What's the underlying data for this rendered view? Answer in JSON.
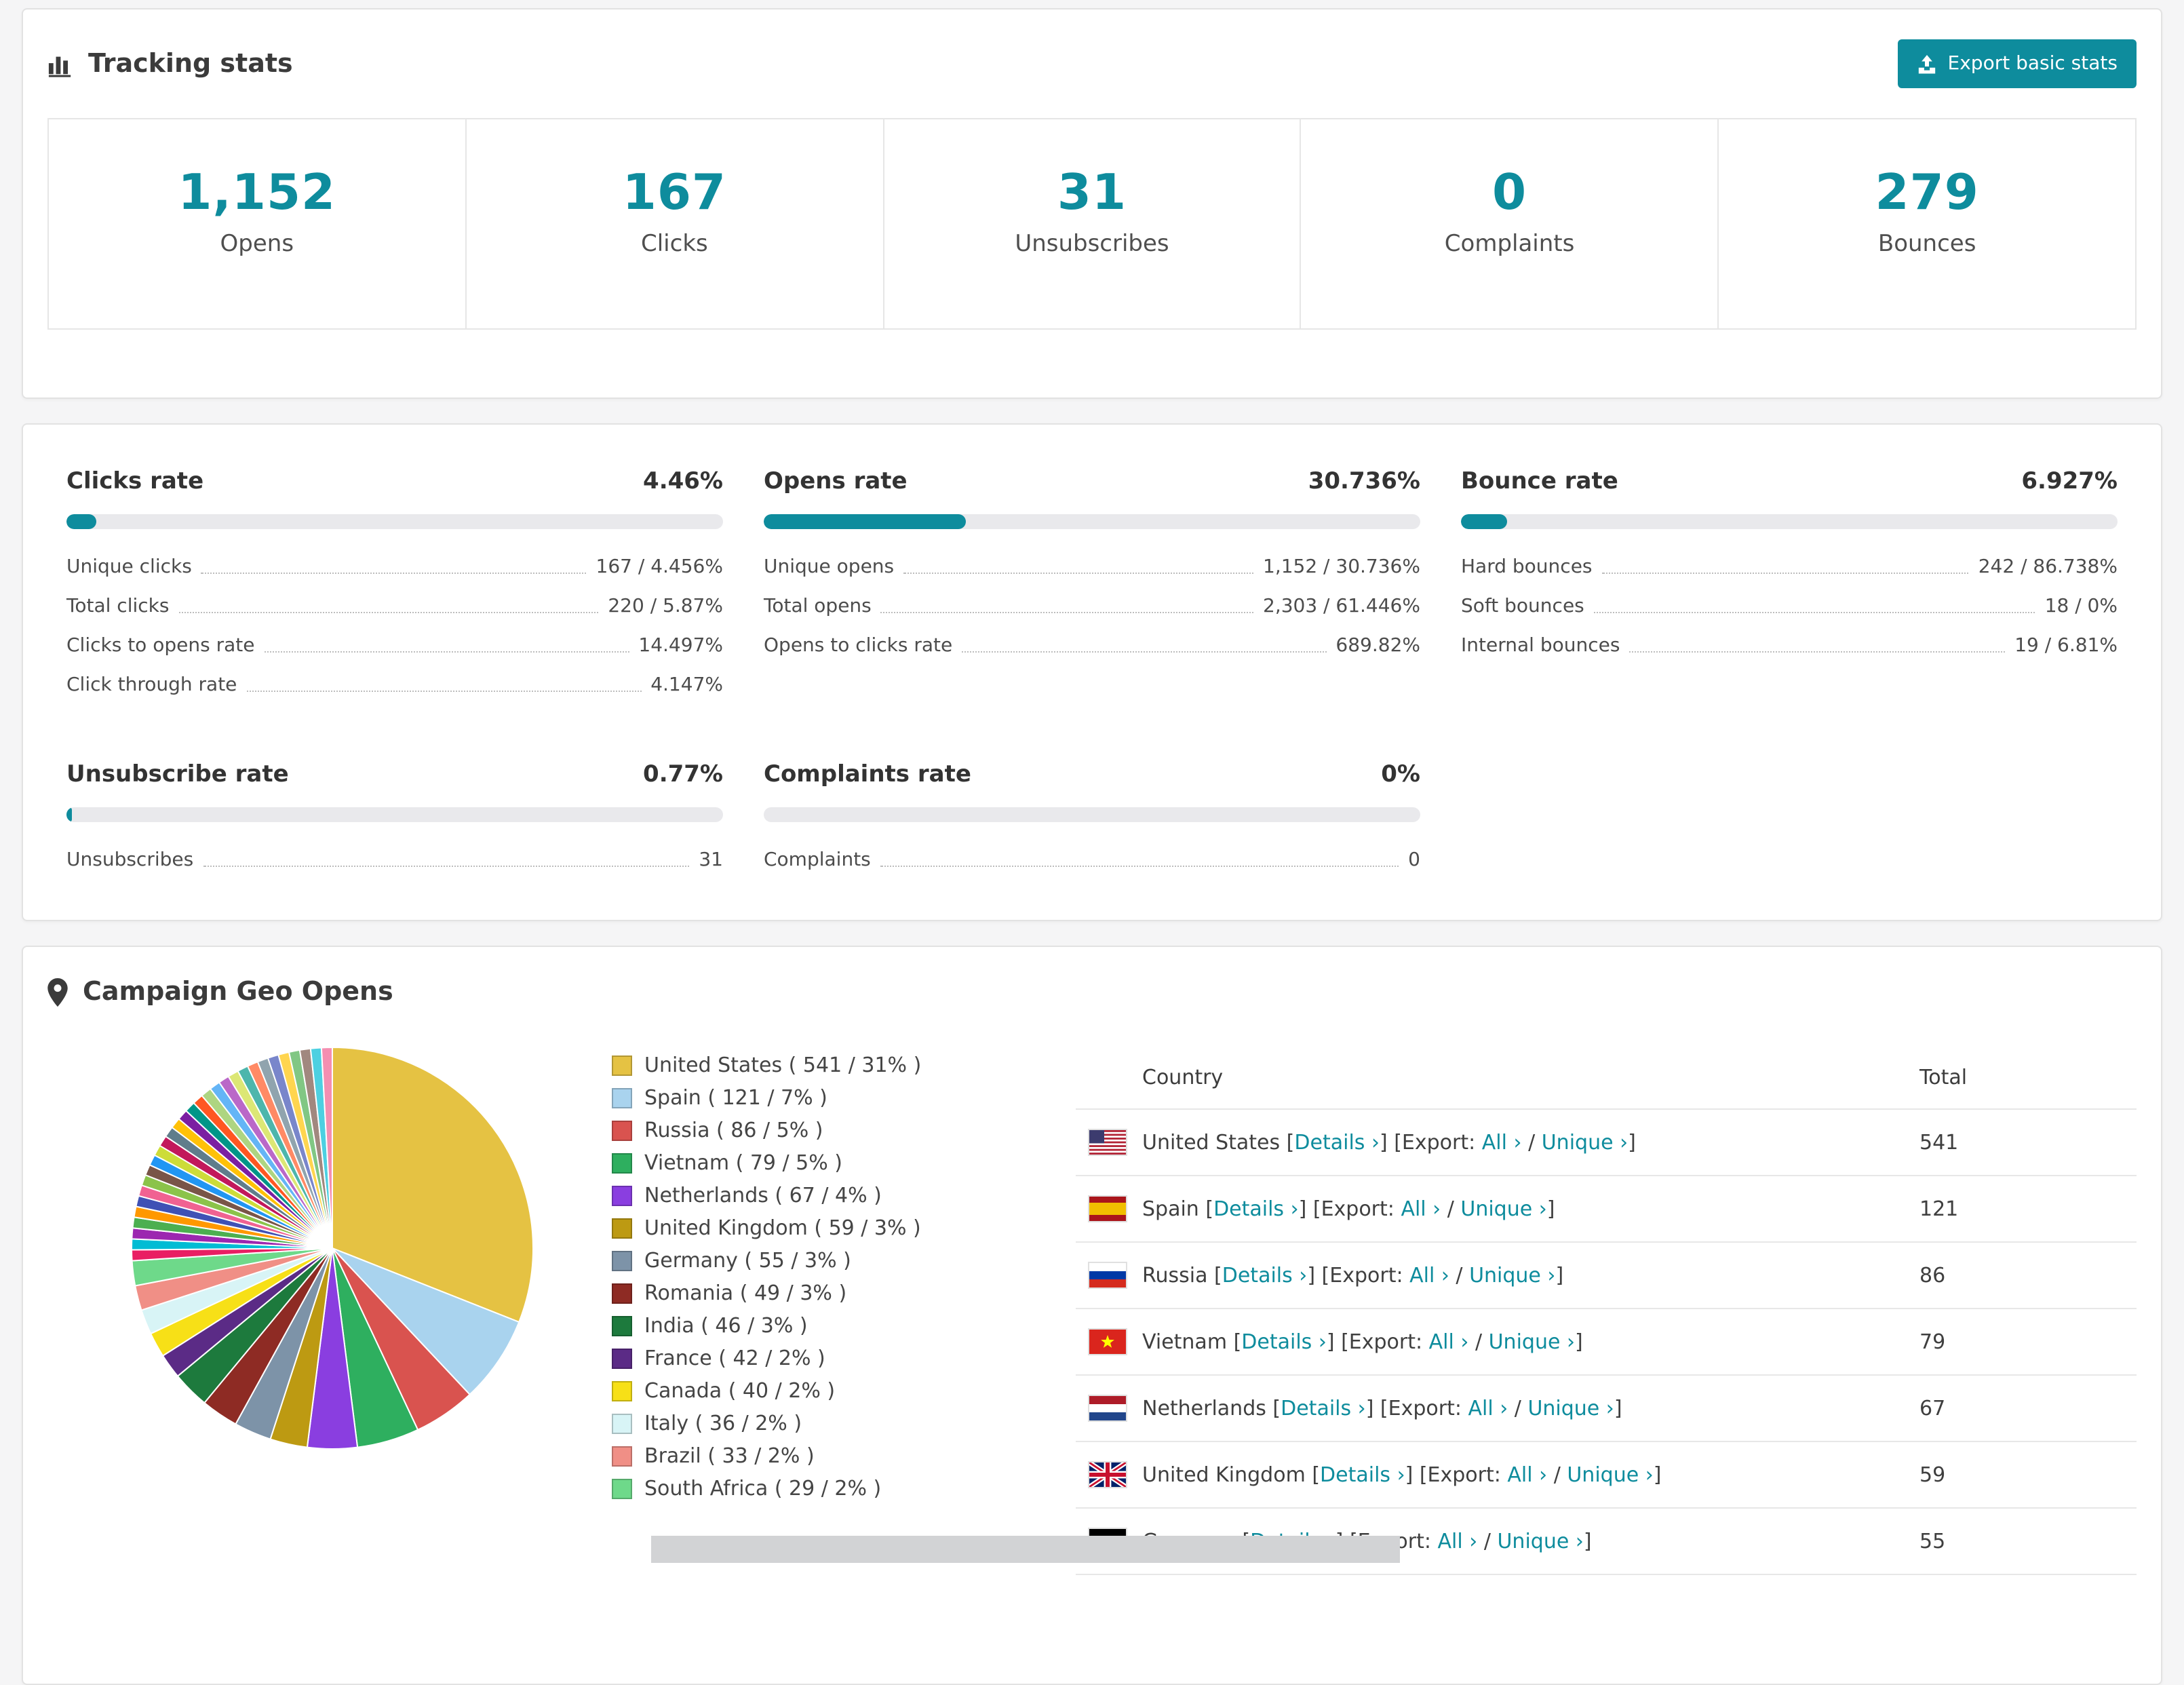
{
  "theme": {
    "accent": "#0e8c9d"
  },
  "tracking": {
    "title": "Tracking stats",
    "export_label": "Export basic stats",
    "stats": [
      {
        "value": "1,152",
        "label": "Opens"
      },
      {
        "value": "167",
        "label": "Clicks"
      },
      {
        "value": "31",
        "label": "Unsubscribes"
      },
      {
        "value": "0",
        "label": "Complaints"
      },
      {
        "value": "279",
        "label": "Bounces"
      }
    ]
  },
  "rates": {
    "blocks": [
      {
        "title": "Clicks rate",
        "value": "4.46%",
        "pct": 4.46,
        "rows": [
          {
            "label": "Unique clicks",
            "value": "167 / 4.456%"
          },
          {
            "label": "Total clicks",
            "value": "220 / 5.87%"
          },
          {
            "label": "Clicks to opens rate",
            "value": "14.497%"
          },
          {
            "label": "Click through rate",
            "value": "4.147%"
          }
        ]
      },
      {
        "title": "Opens rate",
        "value": "30.736%",
        "pct": 30.736,
        "rows": [
          {
            "label": "Unique opens",
            "value": "1,152 / 30.736%"
          },
          {
            "label": "Total opens",
            "value": "2,303 / 61.446%"
          },
          {
            "label": "Opens to clicks rate",
            "value": "689.82%"
          }
        ]
      },
      {
        "title": "Bounce rate",
        "value": "6.927%",
        "pct": 6.927,
        "rows": [
          {
            "label": "Hard bounces",
            "value": "242 / 86.738%"
          },
          {
            "label": "Soft bounces",
            "value": "18 / 0%"
          },
          {
            "label": "Internal bounces",
            "value": "19 / 6.81%"
          }
        ]
      },
      {
        "title": "Unsubscribe rate",
        "value": "0.77%",
        "pct": 0.77,
        "rows": [
          {
            "label": "Unsubscribes",
            "value": "31"
          }
        ]
      },
      {
        "title": "Complaints rate",
        "value": "0%",
        "pct": 0,
        "rows": [
          {
            "label": "Complaints",
            "value": "0"
          }
        ]
      }
    ]
  },
  "geo": {
    "title": "Campaign Geo Opens",
    "table": {
      "country_header": "Country",
      "total_header": "Total",
      "details_label": "Details ›",
      "export_label": "Export:",
      "all_label": "All ›",
      "unique_label": "Unique ›",
      "rows": [
        {
          "country": "United States",
          "flag": "us",
          "total": "541"
        },
        {
          "country": "Spain",
          "flag": "es",
          "total": "121"
        },
        {
          "country": "Russia",
          "flag": "ru",
          "total": "86"
        },
        {
          "country": "Vietnam",
          "flag": "vn",
          "total": "79"
        },
        {
          "country": "Netherlands",
          "flag": "nl",
          "total": "67"
        },
        {
          "country": "United Kingdom",
          "flag": "gb",
          "total": "59"
        },
        {
          "country": "Germany",
          "flag": "de",
          "total": "55"
        }
      ]
    }
  },
  "chart_data": {
    "type": "pie",
    "title": "Campaign Geo Opens",
    "legend_position": "right",
    "unit": "opens",
    "slices": [
      {
        "name": "United States",
        "value": 541,
        "pct": 31,
        "color": "#e5c243"
      },
      {
        "name": "Spain",
        "value": 121,
        "pct": 7,
        "color": "#a9d3ee"
      },
      {
        "name": "Russia",
        "value": 86,
        "pct": 5,
        "color": "#d9534f"
      },
      {
        "name": "Vietnam",
        "value": 79,
        "pct": 5,
        "color": "#2eaf5f"
      },
      {
        "name": "Netherlands",
        "value": 67,
        "pct": 4,
        "color": "#8a3ee0"
      },
      {
        "name": "United Kingdom",
        "value": 59,
        "pct": 3,
        "color": "#bd9a12"
      },
      {
        "name": "Germany",
        "value": 55,
        "pct": 3,
        "color": "#7d93a8"
      },
      {
        "name": "Romania",
        "value": 49,
        "pct": 3,
        "color": "#8e2b24"
      },
      {
        "name": "India",
        "value": 46,
        "pct": 3,
        "color": "#1d7a3d"
      },
      {
        "name": "France",
        "value": 42,
        "pct": 2,
        "color": "#5b2b86"
      },
      {
        "name": "Canada",
        "value": 40,
        "pct": 2,
        "color": "#f7e017"
      },
      {
        "name": "Italy",
        "value": 36,
        "pct": 2,
        "color": "#d8f4f6"
      },
      {
        "name": "Brazil",
        "value": 33,
        "pct": 2,
        "color": "#f08f86"
      },
      {
        "name": "South Africa",
        "value": 29,
        "pct": 2,
        "color": "#6ed98a"
      }
    ],
    "others_pct": 26,
    "others_colors": [
      "#e91e63",
      "#00bcd4",
      "#9c27b0",
      "#4caf50",
      "#ff9800",
      "#3f51b5",
      "#f06292",
      "#8bc34a",
      "#795548",
      "#2196f3",
      "#cddc39",
      "#c2185b",
      "#607d8b",
      "#ffc107",
      "#7b1fa2",
      "#009688",
      "#ff5722",
      "#aed581",
      "#64b5f6",
      "#ba68c8",
      "#dce775",
      "#4db6ac",
      "#ff8a65",
      "#90a4ae",
      "#7986cb",
      "#ffd54f",
      "#81c784",
      "#a1887f",
      "#4dd0e1",
      "#f48fb1"
    ]
  }
}
